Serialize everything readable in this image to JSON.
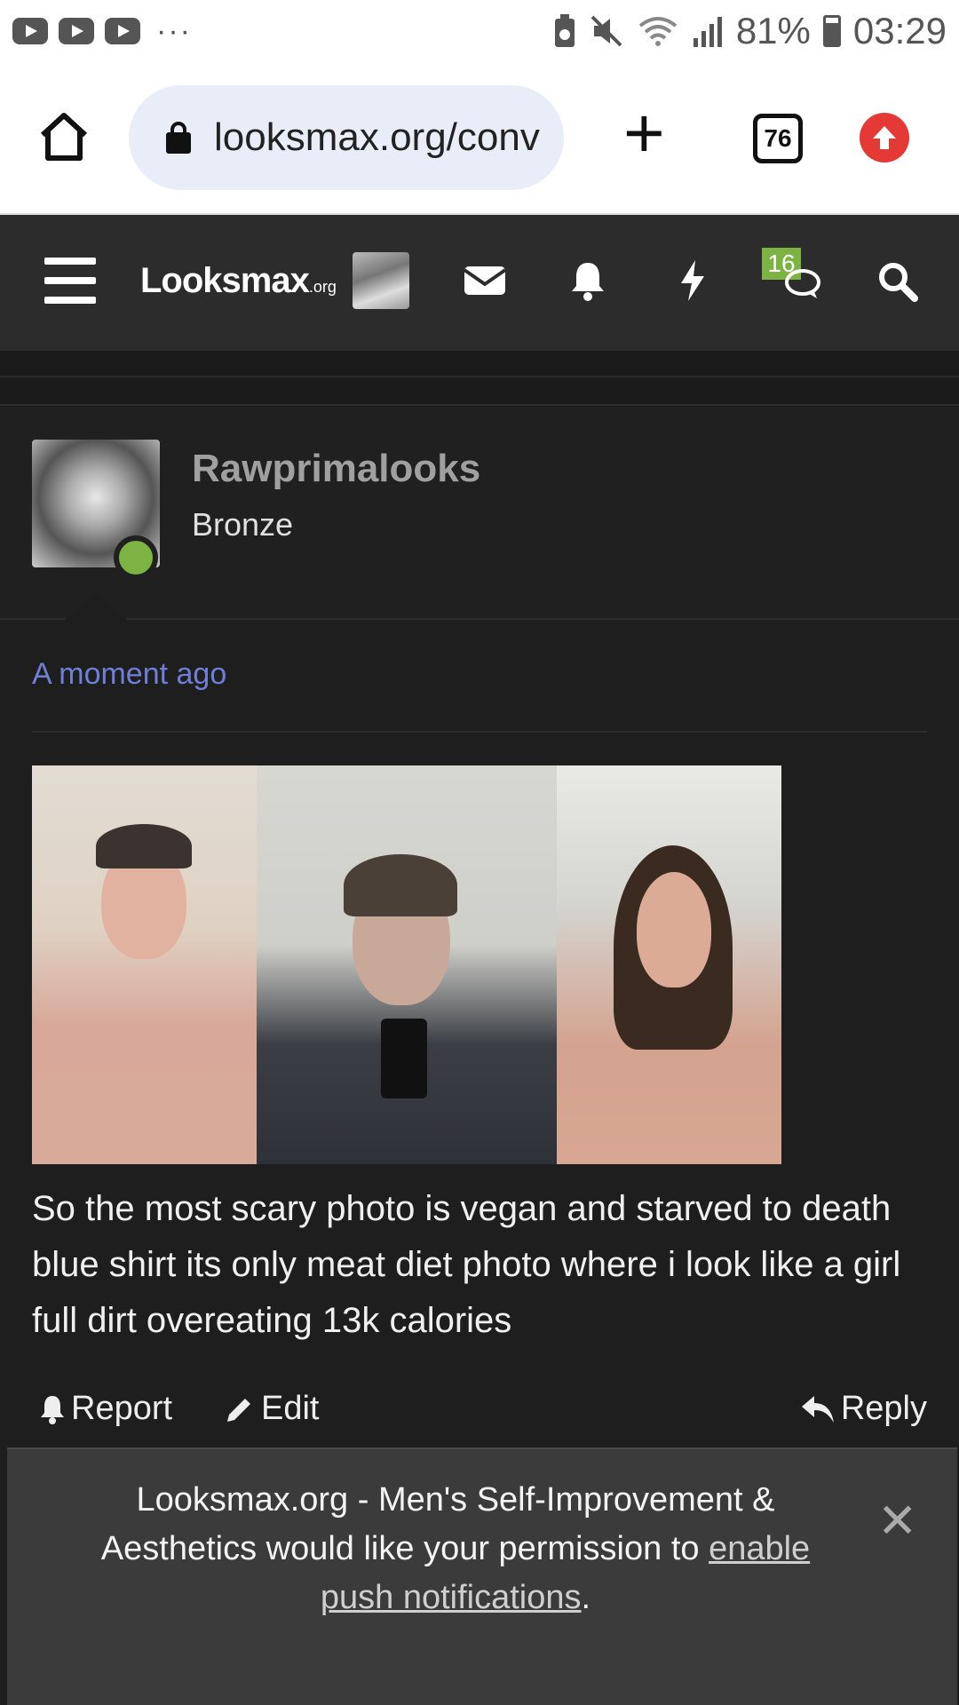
{
  "status_bar": {
    "battery_pct": "81%",
    "time": "03:29",
    "more_dots": "···"
  },
  "browser": {
    "url": "looksmax.org/conv",
    "tab_count": "76",
    "new_tab_label": "+"
  },
  "site": {
    "logo_main": "Looksmax",
    "logo_suffix": ".org",
    "conversations_badge": "16"
  },
  "user": {
    "name": "Rawprimalooks",
    "rank": "Bronze"
  },
  "post": {
    "time": "A moment ago",
    "body": "So the most scary photo is vegan and starved to death blue shirt its only meat diet photo where i look like a girl full dirt overeating 13k calories",
    "actions": {
      "report": "Report",
      "edit": "Edit",
      "reply": "Reply"
    }
  },
  "push_notice": {
    "text_before": "Looksmax.org - Men's Self-Improvement & Aesthetics would like your permission to ",
    "link": "enable push notifications",
    "text_after": ".",
    "close": "✕"
  },
  "colors": {
    "header_bg": "#2c2c2c",
    "page_bg": "#1e1e1e",
    "accent_link": "#6f7fd6",
    "online_green": "#7cb342",
    "update_red": "#e53935"
  }
}
